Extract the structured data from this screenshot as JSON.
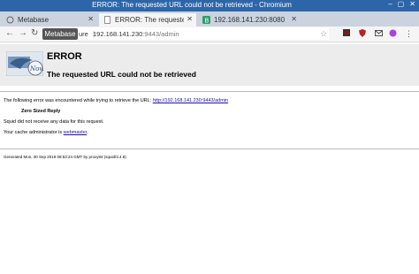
{
  "window": {
    "title": "ERROR: The requested URL could not be retrieved - Chromium"
  },
  "tabs": [
    {
      "label": "Metabase"
    },
    {
      "label": "ERROR: The requested U"
    },
    {
      "label": "192.168.141.230:8080/e"
    }
  ],
  "omnibox": {
    "security": "ure",
    "host": "192.168.141.230",
    "port_path": ":9443/admin"
  },
  "tooltip": "Metabase",
  "page": {
    "heading": "ERROR",
    "subheading": "The requested URL could not be retrieved",
    "line1_prefix": "The following error was encountered while trying to retrieve the URL:",
    "line1_url": "http://192.168.141.230:9443/admin",
    "error_name": "Zero Sized Reply",
    "line2": "Squid did not receive any data for this request.",
    "line3_prefix": "Your cache administrator is",
    "line3_link": "webmaster",
    "line3_suffix": ".",
    "footer": "Generated Mon, 30 Sep 2019 08:53:24 GMT by proxy84 (squid/3.4.8)"
  },
  "colors": {
    "titlebar": "#2d66a8",
    "link": "#1a0dab"
  }
}
